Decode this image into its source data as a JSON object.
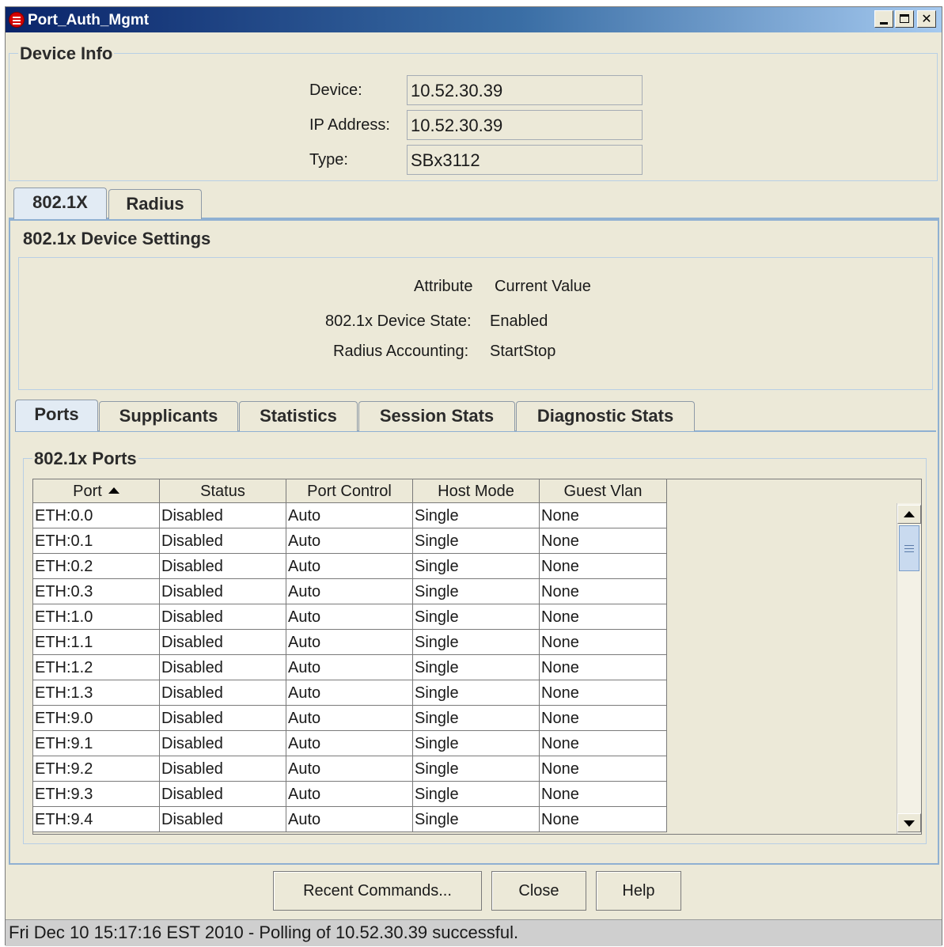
{
  "window": {
    "title": "Port_Auth_Mgmt"
  },
  "device_info": {
    "title": "Device Info",
    "fields": [
      {
        "label": "Device:",
        "value": "10.52.30.39"
      },
      {
        "label": "IP Address:",
        "value": "10.52.30.39"
      },
      {
        "label": "Type:",
        "value": "SBx3112"
      }
    ]
  },
  "top_tabs": [
    {
      "label": "802.1X",
      "active": true
    },
    {
      "label": "Radius",
      "active": false
    }
  ],
  "device_settings": {
    "title": "802.1x Device Settings",
    "header_attribute": "Attribute",
    "header_value": "Current Value",
    "rows": [
      {
        "attribute": "802.1x Device State:",
        "value": "Enabled"
      },
      {
        "attribute": "Radius Accounting:",
        "value": "StartStop"
      }
    ]
  },
  "inner_tabs": [
    {
      "label": "Ports",
      "active": true
    },
    {
      "label": "Supplicants",
      "active": false
    },
    {
      "label": "Statistics",
      "active": false
    },
    {
      "label": "Session Stats",
      "active": false
    },
    {
      "label": "Diagnostic Stats",
      "active": false
    }
  ],
  "ports_table": {
    "title": "802.1x Ports",
    "columns": [
      "Port",
      "Status",
      "Port Control",
      "Host Mode",
      "Guest Vlan"
    ],
    "rows": [
      [
        "ETH:0.0",
        "Disabled",
        "Auto",
        "Single",
        "None"
      ],
      [
        "ETH:0.1",
        "Disabled",
        "Auto",
        "Single",
        "None"
      ],
      [
        "ETH:0.2",
        "Disabled",
        "Auto",
        "Single",
        "None"
      ],
      [
        "ETH:0.3",
        "Disabled",
        "Auto",
        "Single",
        "None"
      ],
      [
        "ETH:1.0",
        "Disabled",
        "Auto",
        "Single",
        "None"
      ],
      [
        "ETH:1.1",
        "Disabled",
        "Auto",
        "Single",
        "None"
      ],
      [
        "ETH:1.2",
        "Disabled",
        "Auto",
        "Single",
        "None"
      ],
      [
        "ETH:1.3",
        "Disabled",
        "Auto",
        "Single",
        "None"
      ],
      [
        "ETH:9.0",
        "Disabled",
        "Auto",
        "Single",
        "None"
      ],
      [
        "ETH:9.1",
        "Disabled",
        "Auto",
        "Single",
        "None"
      ],
      [
        "ETH:9.2",
        "Disabled",
        "Auto",
        "Single",
        "None"
      ],
      [
        "ETH:9.3",
        "Disabled",
        "Auto",
        "Single",
        "None"
      ],
      [
        "ETH:9.4",
        "Disabled",
        "Auto",
        "Single",
        "None"
      ]
    ]
  },
  "buttons": {
    "recent_commands": "Recent Commands...",
    "close": "Close",
    "help": "Help"
  },
  "status_bar": {
    "text": "Fri Dec 10 15:17:16 EST 2010 - Polling of 10.52.30.39 successful."
  },
  "colors": {
    "title_bar_start": "#0A246A",
    "title_bar_end": "#A6CAF0",
    "window_bg": "#ECE9D8",
    "active_tab": "#E2EBF4",
    "status_bar_bg": "#CFCFCF"
  }
}
